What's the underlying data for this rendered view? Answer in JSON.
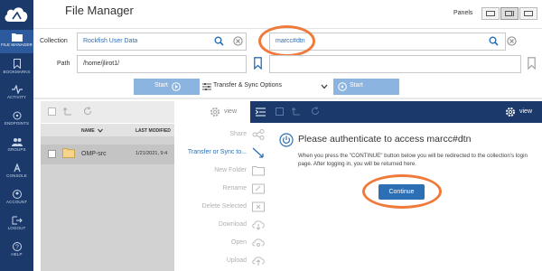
{
  "sidebar": {
    "items": [
      {
        "label": "FILE MANAGER",
        "icon": "folder-icon"
      },
      {
        "label": "BOOKMARKS",
        "icon": "bookmark-icon"
      },
      {
        "label": "ACTIVITY",
        "icon": "activity-icon"
      },
      {
        "label": "ENDPOINTS",
        "icon": "endpoints-icon"
      },
      {
        "label": "GROUPS",
        "icon": "groups-icon"
      },
      {
        "label": "CONSOLE",
        "icon": "console-icon"
      },
      {
        "label": "ACCOUNT",
        "icon": "account-icon"
      },
      {
        "label": "LOGOUT",
        "icon": "logout-icon"
      },
      {
        "label": "HELP",
        "icon": "help-icon"
      }
    ]
  },
  "header": {
    "title": "File Manager",
    "panels_label": "Panels"
  },
  "left": {
    "collection_label": "Collection",
    "collection_value": "Rockfish User Data",
    "path_label": "Path",
    "path_value": "/home/jlirot1/",
    "start_label": "Start",
    "columns": {
      "name": "NAME",
      "modified": "LAST MODIFIED"
    },
    "files": [
      {
        "name": "OMP-src",
        "modified": "1/21/2021, 9:4"
      }
    ],
    "view_label": "view"
  },
  "right": {
    "collection_value": "marcc#dtn",
    "path_value": "",
    "start_label": "Start",
    "view_label": "view"
  },
  "transfer_options_label": "Transfer & Sync Options",
  "actions": [
    {
      "label": "Share",
      "active": false
    },
    {
      "label": "Transfer or Sync to...",
      "active": true
    },
    {
      "label": "New Folder",
      "active": false
    },
    {
      "label": "Rename",
      "active": false
    },
    {
      "label": "Delete Selected",
      "active": false
    },
    {
      "label": "Download",
      "active": false
    },
    {
      "label": "Open",
      "active": false
    },
    {
      "label": "Upload",
      "active": false
    }
  ],
  "auth": {
    "title": "Please authenticate to access marcc#dtn",
    "message": "When you press the \"CONTINUE\" button below you will be redirected to the collection's login page. After logging in, you will be returned here.",
    "continue_label": "Continue"
  },
  "colors": {
    "sidebar_bg": "#1b3a6b",
    "accent": "#2c6fb5",
    "annotation": "#ef7a3a"
  }
}
